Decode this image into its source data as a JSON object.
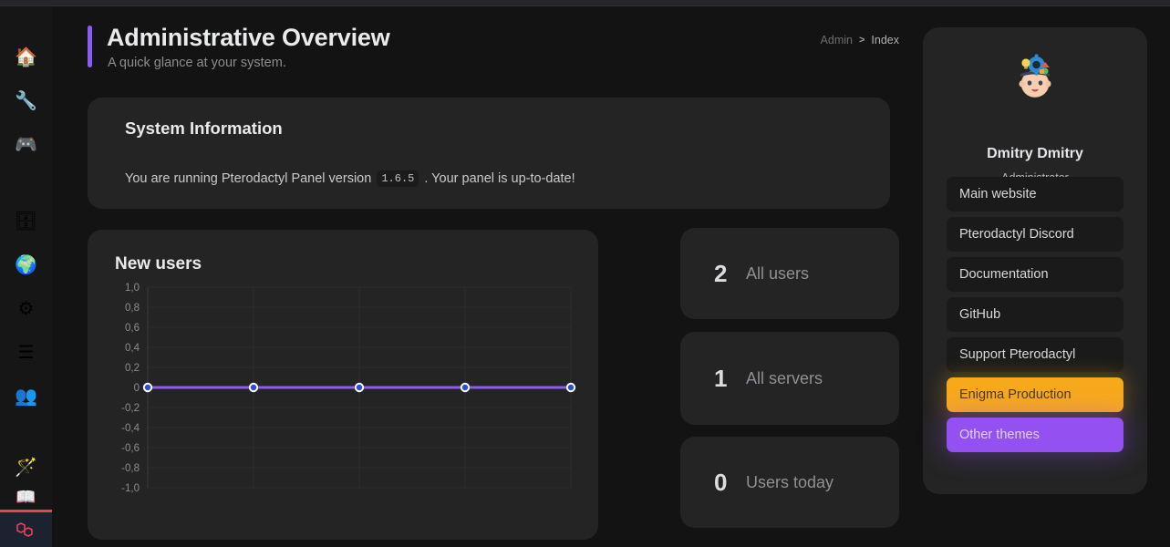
{
  "app": {
    "background_color": "#131313",
    "card_color": "#242424",
    "accent_color": "#8b5cf6"
  },
  "sidebar": {
    "items": [
      {
        "icon": "home-icon",
        "glyph": "🏠",
        "label": "Home",
        "active": true
      },
      {
        "icon": "wrench-icon",
        "glyph": "🔧",
        "label": "Settings",
        "active": false
      },
      {
        "icon": "gamepad-icon",
        "glyph": "🎮",
        "label": "Games",
        "active": false
      },
      {
        "icon": "database-icon",
        "glyph": "🗄",
        "label": "Databases",
        "active": false
      },
      {
        "icon": "globe-icon",
        "glyph": "🌍",
        "label": "Locations",
        "active": false
      },
      {
        "icon": "sitemap-icon",
        "glyph": "⚙",
        "label": "Nodes",
        "active": false
      },
      {
        "icon": "server-list-icon",
        "glyph": "☰",
        "label": "Servers",
        "active": false
      },
      {
        "icon": "users-icon",
        "glyph": "👥",
        "label": "Users",
        "active": false
      },
      {
        "icon": "magic-wand-icon",
        "glyph": "🪄",
        "label": "Themes",
        "active": false
      },
      {
        "icon": "books-icon",
        "glyph": "📖",
        "label": "Docs",
        "active": false
      }
    ],
    "debugbar_icon": "laravel-logo-icon"
  },
  "header": {
    "title": "Administrative Overview",
    "subtitle": "A quick glance at your system.",
    "breadcrumb": {
      "root": "Admin",
      "separator": ">",
      "current": "Index"
    }
  },
  "system_information": {
    "title": "System Information",
    "text_before": "You are running Pterodactyl Panel version",
    "version": "1.6.5",
    "text_after": ". Your panel is up-to-date!"
  },
  "chart_data": {
    "type": "line",
    "title": "New users",
    "x": [
      1,
      2,
      3,
      4,
      5
    ],
    "values": [
      0,
      0,
      0,
      0,
      0
    ],
    "series": [
      {
        "name": "New users",
        "values": [
          0,
          0,
          0,
          0,
          0
        ]
      }
    ],
    "xlabel": "",
    "ylabel": "",
    "ylim": [
      -1,
      1
    ],
    "yticks": [
      1,
      0.8,
      0.6,
      0.4,
      0.2,
      0,
      -0.2,
      -0.4,
      -0.6,
      -0.8,
      -1
    ],
    "ytick_labels": [
      "1,0",
      "0,8",
      "0,6",
      "0,4",
      "0,2",
      "0",
      "-0,2",
      "-0,4",
      "-0,6",
      "-0,8",
      "-1,0"
    ],
    "xtick_labels": [
      "",
      "",
      "",
      "",
      ""
    ],
    "grid": true,
    "legend": false,
    "line_color": "#8b5cf6",
    "point_fill_color": "#2c4cdb",
    "point_stroke_color": "#ffffff"
  },
  "stats": [
    {
      "value": "2",
      "label": "All users"
    },
    {
      "value": "1",
      "label": "All servers"
    },
    {
      "value": "0",
      "label": "Users today"
    }
  ],
  "profile": {
    "avatar_icon": "user-avatar-image",
    "name": "Dmitry Dmitry",
    "role": "Administrator",
    "links": [
      {
        "label": "Main website",
        "style": "default"
      },
      {
        "label": "Pterodactyl Discord",
        "style": "default"
      },
      {
        "label": "Documentation",
        "style": "default"
      },
      {
        "label": "GitHub",
        "style": "default"
      },
      {
        "label": "Support Pterodactyl",
        "style": "default"
      },
      {
        "label": "Enigma Production",
        "style": "orange"
      },
      {
        "label": "Other themes",
        "style": "purple"
      }
    ]
  }
}
